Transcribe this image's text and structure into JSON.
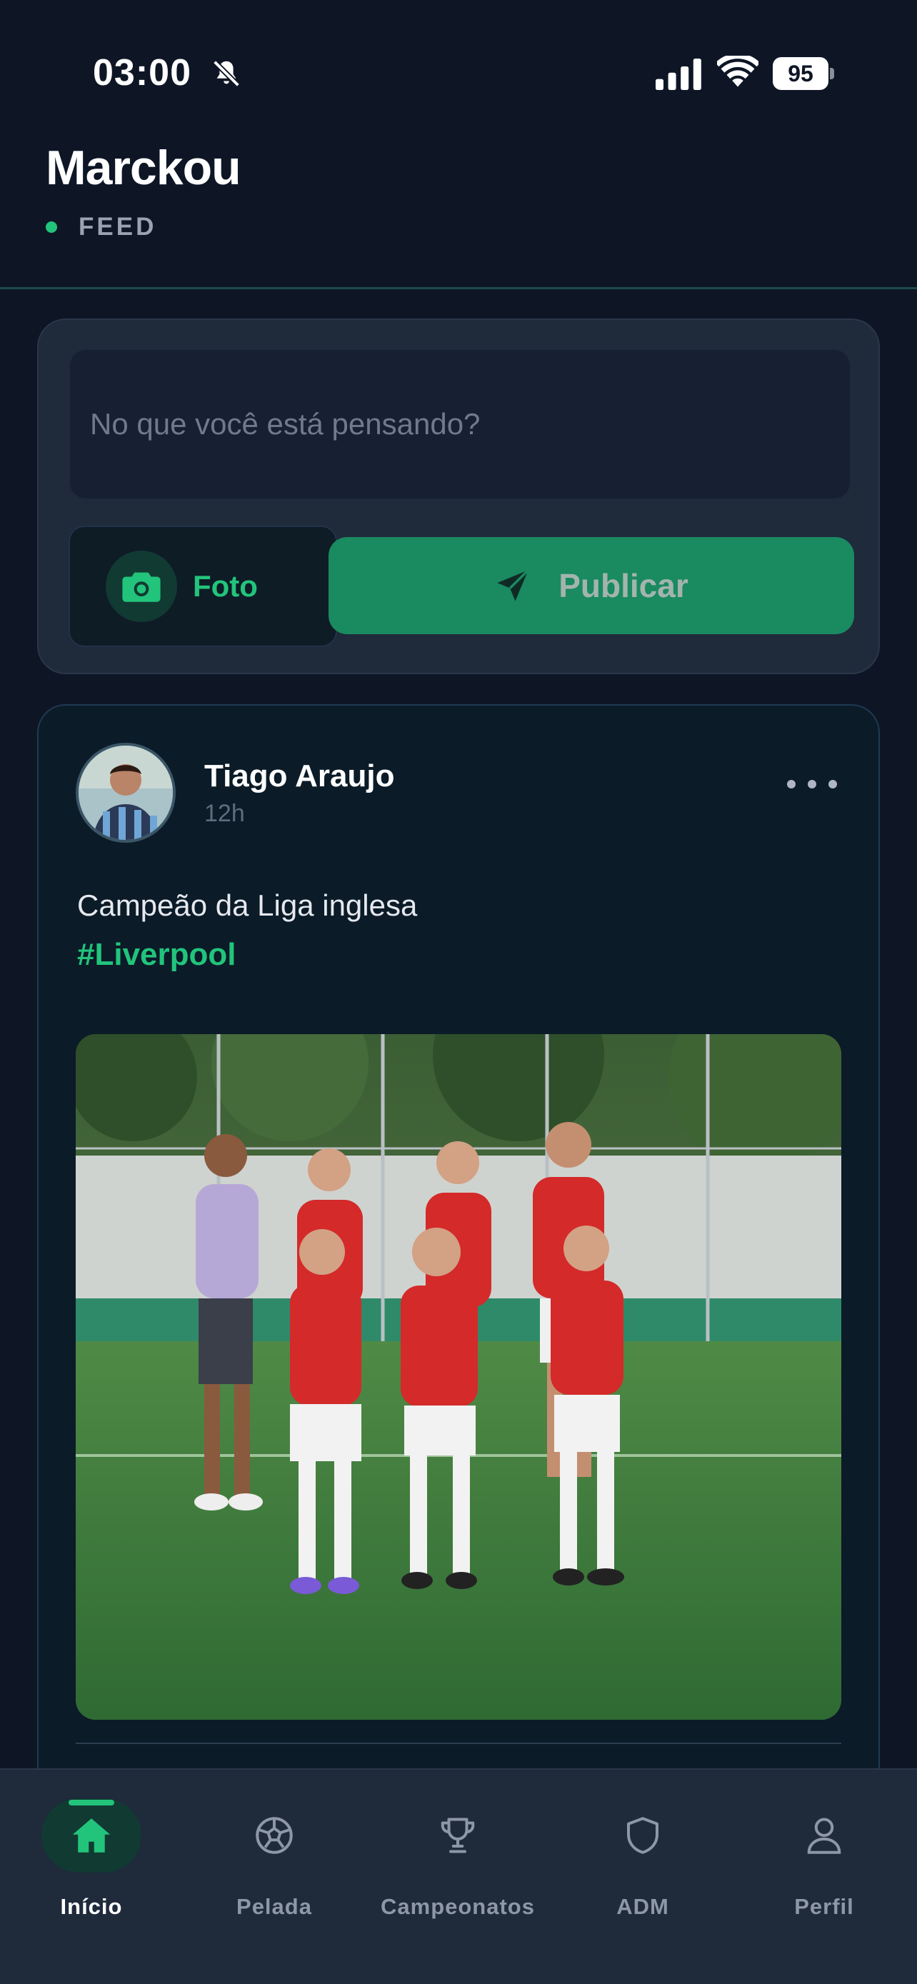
{
  "status_bar": {
    "time": "03:00",
    "battery": "95",
    "icons": [
      "bell-slash-icon",
      "signal-icon",
      "wifi-icon",
      "battery-icon"
    ]
  },
  "header": {
    "title": "Marckou",
    "subtitle": "FEED"
  },
  "composer": {
    "placeholder": "No que você está pensando?",
    "photo_label": "Foto",
    "publish_label": "Publicar"
  },
  "post": {
    "author": "Tiago Araujo",
    "time": "12h",
    "text": "Campeão da Liga inglesa",
    "hashtag": "#Liverpool"
  },
  "nav": {
    "items": [
      {
        "label": "Início",
        "icon": "home-icon",
        "active": true
      },
      {
        "label": "Pelada",
        "icon": "soccer-ball-icon",
        "active": false
      },
      {
        "label": "Campeonatos",
        "icon": "trophy-icon",
        "active": false
      },
      {
        "label": "ADM",
        "icon": "shield-icon",
        "active": false
      },
      {
        "label": "Perfil",
        "icon": "user-icon",
        "active": false
      }
    ]
  },
  "colors": {
    "background": "#0e1626",
    "accent": "#22c47b",
    "publish_button": "#1a8a60",
    "card": "#1f2a3b"
  }
}
